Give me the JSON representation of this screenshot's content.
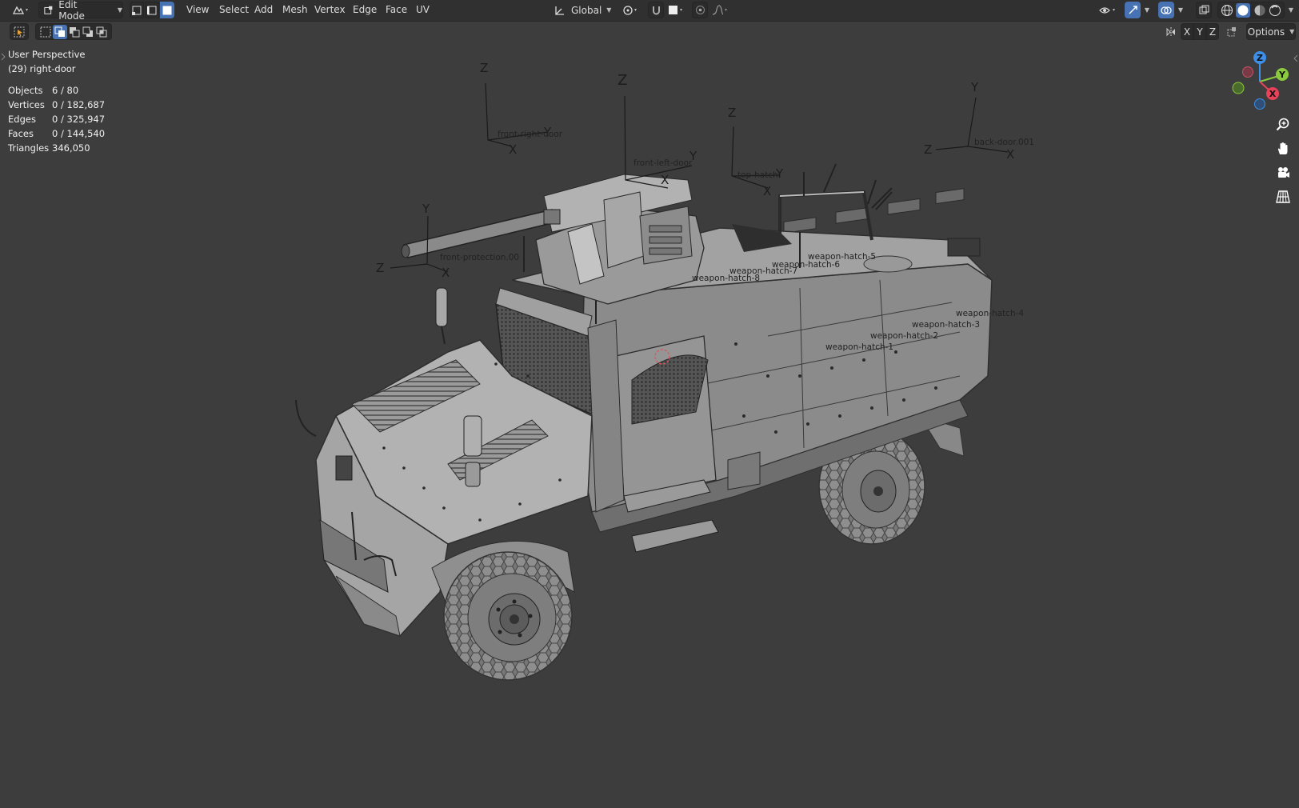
{
  "header": {
    "mode_label": "Edit Mode",
    "menus": [
      "View",
      "Select",
      "Add",
      "Mesh",
      "Vertex",
      "Edge",
      "Face",
      "UV"
    ],
    "transform_orientation": "Global",
    "options_label": "Options",
    "axis_toggles": [
      "X",
      "Y",
      "Z"
    ]
  },
  "viewport": {
    "view_name": "User Perspective",
    "active_object": "(29) right-door",
    "stats": [
      {
        "label": "Objects",
        "value": "6 / 80"
      },
      {
        "label": "Vertices",
        "value": "0 / 182,687"
      },
      {
        "label": "Edges",
        "value": "0 / 325,947"
      },
      {
        "label": "Faces",
        "value": "0 / 144,540"
      },
      {
        "label": "Triangles",
        "value": "346,050"
      }
    ],
    "object_labels": [
      "front-right-door",
      "front-left-door",
      "top-hatch",
      "back-door.001",
      "front-protection.00",
      "weapon-hatch-8",
      "weapon-hatch-7",
      "weapon-hatch-6",
      "weapon-hatch-5",
      "weapon-hatch-4",
      "weapon-hatch-3",
      "weapon-hatch-2",
      "weapon-hatch-1"
    ],
    "empty_axes": {
      "x": "X",
      "y": "Y",
      "z": "Z"
    },
    "gizmo_axes": {
      "x": "X",
      "y": "Y",
      "z": "Z"
    }
  },
  "icons": {
    "header": [
      "editor-type-icon",
      "edit-mode-icon",
      "vertex-select-icon",
      "edge-select-icon",
      "face-select-icon",
      "transform-orientation-icon",
      "pivot-icon",
      "snap-icon",
      "snap-target-icon",
      "proportional-editing-icon",
      "falloff-icon",
      "visibility-icon",
      "gizmo-icon",
      "overlay-icon",
      "xray-icon",
      "wireframe-shading-icon",
      "solid-shading-icon",
      "material-shading-icon",
      "rendered-shading-icon"
    ],
    "navigation": [
      "zoom-icon",
      "pan-hand-icon",
      "camera-icon",
      "ortho-grid-icon"
    ]
  },
  "colors": {
    "header_bg": "#303030",
    "viewport_bg": "#3d3d3d",
    "active_blue": "#4772b3",
    "axis_x": "#e8425a",
    "axis_y": "#8bc93e",
    "axis_z": "#3d8fe8"
  }
}
